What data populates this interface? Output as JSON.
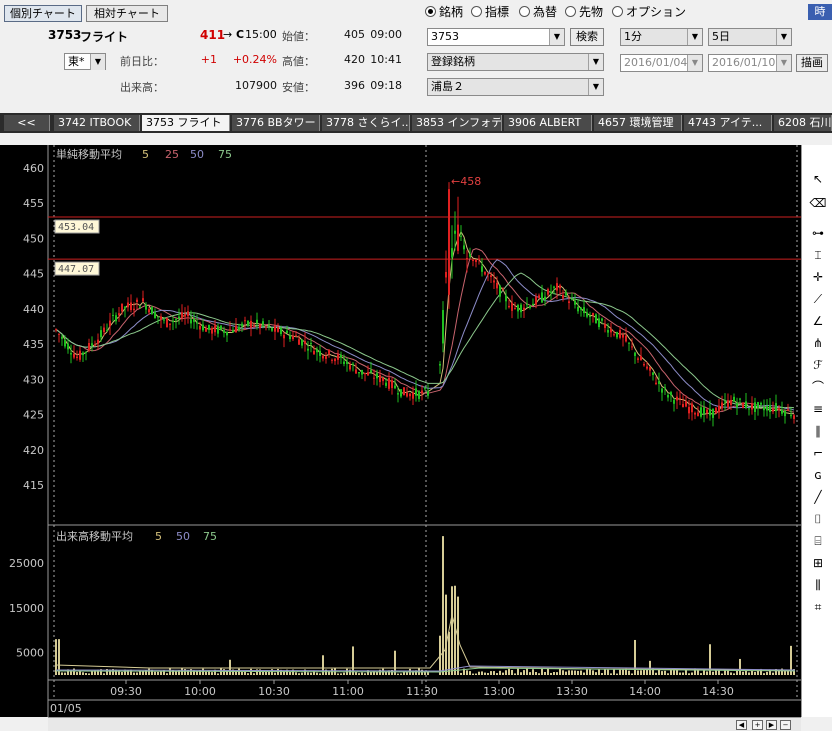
{
  "tabs": {
    "individual": "個別チャート",
    "relative": "相対チャート"
  },
  "stock": {
    "code": "3753",
    "name": "フライト",
    "price": "411",
    "arrow": "→",
    "status": "C",
    "time": "15:00",
    "market": "東*",
    "change_label": "前日比：",
    "change": "+1",
    "change_pct": "+0.24%",
    "volume_label": "出来高：",
    "volume": "107900",
    "open_label": "始値：",
    "open": "405",
    "open_time": "09:00",
    "high_label": "高値：",
    "high": "420",
    "high_time": "10:41",
    "low_label": "安値：",
    "low": "396",
    "low_time": "09:18"
  },
  "search": {
    "radios": [
      "銘柄",
      "指標",
      "為替",
      "先物",
      "オプション"
    ],
    "code_value": "3753",
    "search_button": "検索",
    "registered": "登録銘柄",
    "list": "浦島２"
  },
  "period": {
    "interval": "1分",
    "span": "5日",
    "from": "2016/01/04",
    "to": "2016/01/10",
    "draw_button": "描画"
  },
  "corner_label": "時",
  "strip": {
    "back": "<<",
    "items": [
      "3742 ITBOOK",
      "3753 フライト",
      "3776 BBタワー",
      "3778 さくらイ...",
      "3853 インフォテリ",
      "3906 ALBERT",
      "4657 環境管理",
      "4743 アイテ...",
      "6208 石川"
    ]
  },
  "chart": {
    "price_legend": "単純移動平均",
    "ma_periods": [
      "5",
      "25",
      "50",
      "75"
    ],
    "ma_colors": [
      "#d4c07a",
      "#c8646e",
      "#8c8cc8",
      "#8cc88c"
    ],
    "high_marker": "←458",
    "level1": "453.04",
    "level2": "447.07",
    "y_ticks": [
      "460",
      "455",
      "450",
      "445",
      "440",
      "435",
      "430",
      "425",
      "420",
      "415"
    ],
    "volume_legend": "出来高移動平均",
    "vol_ma_periods": [
      "5",
      "50",
      "75"
    ],
    "vol_ticks": [
      "25000",
      "15000",
      "5000"
    ],
    "x_ticks": [
      "09:30",
      "10:00",
      "10:30",
      "11:00",
      "11:30",
      "13:00",
      "13:30",
      "14:00",
      "14:30"
    ],
    "date": "01/05"
  },
  "chart_data": {
    "type": "candlestick",
    "interval": "1分",
    "date": "01/05",
    "x_ticks": [
      "09:30",
      "10:00",
      "10:30",
      "11:00",
      "11:30",
      "13:00",
      "13:30",
      "14:00",
      "14:30"
    ],
    "ylim": [
      411,
      462
    ],
    "high": 458,
    "horizontal_lines": [
      453.04,
      447.07
    ],
    "ma_periods": [
      5,
      25,
      50,
      75
    ],
    "close_approx": [
      [
        0,
        437
      ],
      [
        10,
        433
      ],
      [
        20,
        436
      ],
      [
        30,
        440
      ],
      [
        40,
        441
      ],
      [
        50,
        438
      ],
      [
        60,
        439
      ],
      [
        70,
        437
      ],
      [
        80,
        437
      ],
      [
        90,
        438
      ],
      [
        100,
        437
      ],
      [
        110,
        436
      ],
      [
        120,
        434
      ],
      [
        130,
        433
      ],
      [
        140,
        431
      ],
      [
        150,
        430
      ],
      [
        160,
        428
      ],
      [
        170,
        428
      ],
      [
        175,
        428
      ],
      [
        180,
        447
      ],
      [
        185,
        451
      ],
      [
        190,
        448
      ],
      [
        200,
        444
      ],
      [
        210,
        440
      ],
      [
        220,
        441
      ],
      [
        230,
        443
      ],
      [
        240,
        440
      ],
      [
        250,
        438
      ],
      [
        260,
        436
      ],
      [
        270,
        432
      ],
      [
        280,
        428
      ],
      [
        290,
        426
      ],
      [
        300,
        425
      ],
      [
        310,
        427
      ],
      [
        320,
        426
      ],
      [
        330,
        426
      ],
      [
        340,
        425
      ]
    ],
    "volume_axis": [
      0,
      30000
    ],
    "volume_ticks": [
      25000,
      15000,
      5000
    ]
  }
}
